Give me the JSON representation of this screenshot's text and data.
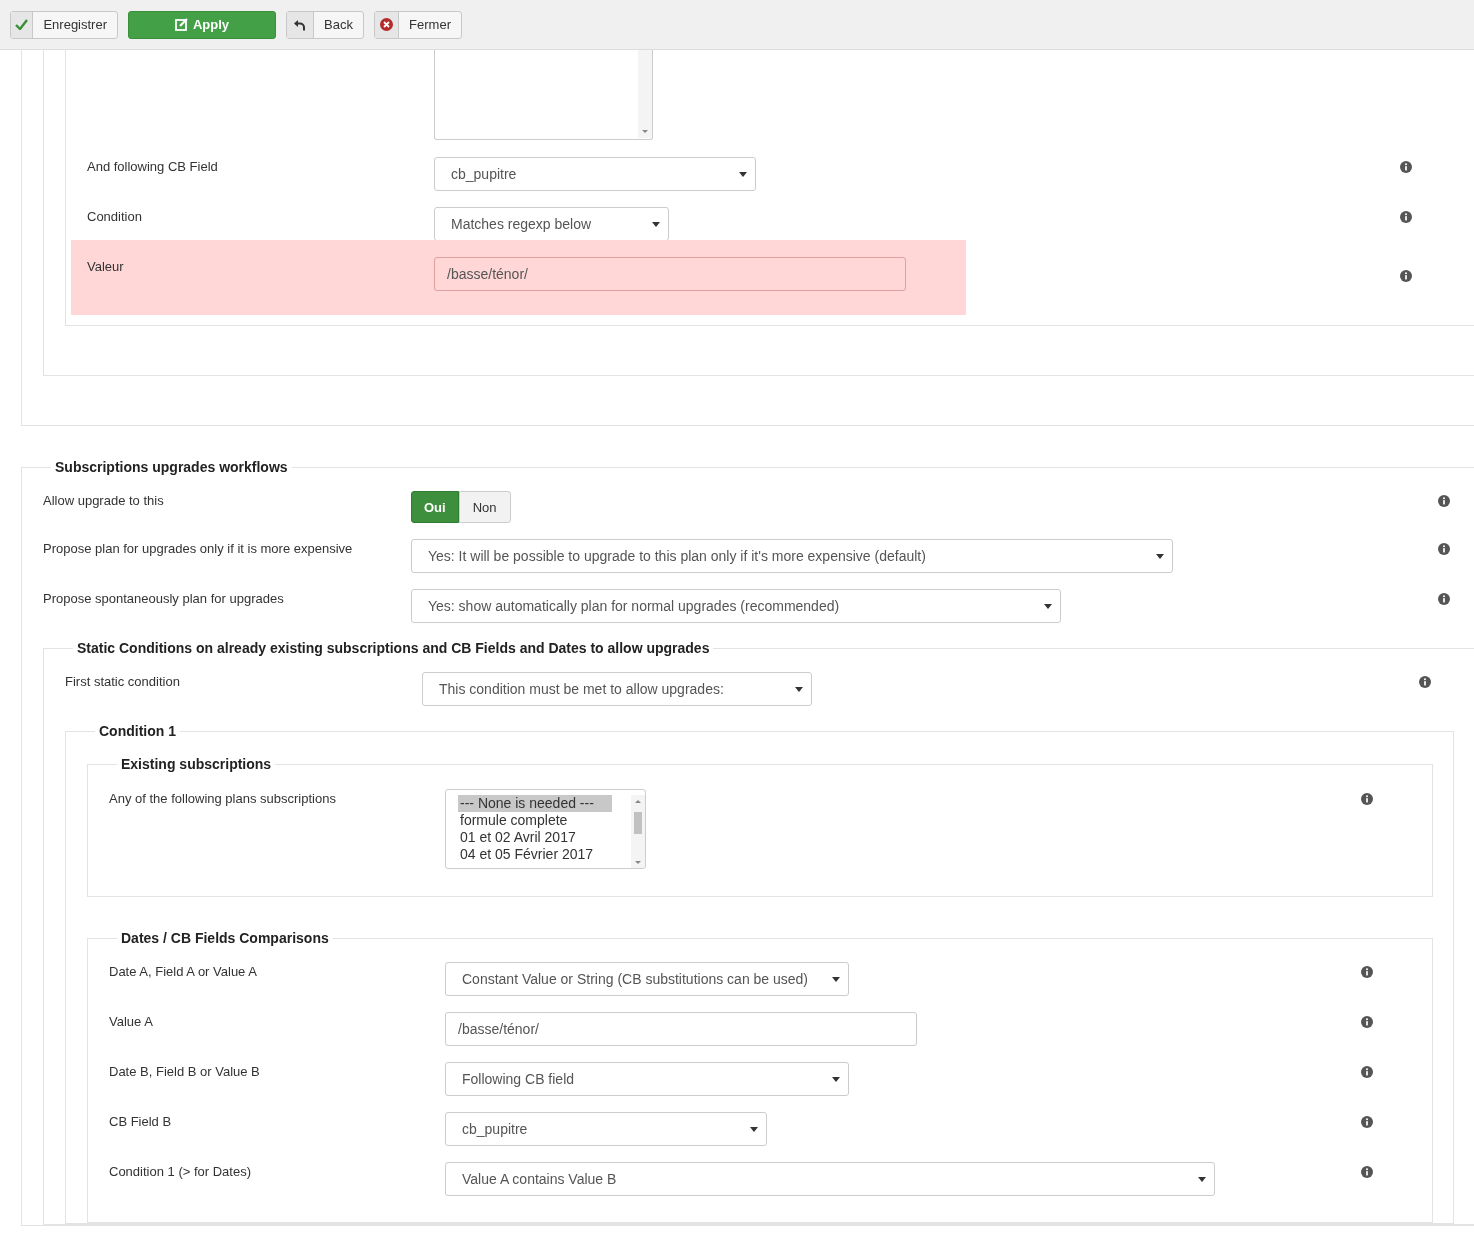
{
  "toolbar": {
    "buttons": [
      {
        "kind": "save",
        "label": "Enregistrer"
      },
      {
        "kind": "apply",
        "label": "Apply"
      },
      {
        "kind": "back",
        "label": "Back"
      },
      {
        "kind": "close",
        "label": "Fermer"
      }
    ]
  },
  "condition_fields": [
    {
      "label": "And following CB Field",
      "kind": "select",
      "value": "cb_pupitre",
      "error": false
    },
    {
      "label": "Condition",
      "kind": "select",
      "value": "Matches regexp below",
      "error": false
    },
    {
      "label": "Valeur",
      "kind": "input",
      "value": "/basse/ténor/",
      "error": true
    }
  ],
  "upgrades": {
    "title": "Subscriptions upgrades workflows",
    "fields": [
      {
        "label": "Allow upgrade to this",
        "kind": "toggle",
        "options": [
          {
            "label": "Oui",
            "selected": true
          },
          {
            "label": "Non",
            "selected": false
          }
        ]
      },
      {
        "label": "Propose plan for upgrades only if it is more expensive",
        "kind": "select",
        "value": "Yes: It will be possible to upgrade to this plan only if it's more expensive (default)"
      },
      {
        "label": "Propose spontaneously plan for upgrades",
        "kind": "select",
        "value": "Yes: show automatically plan for normal upgrades (recommended)"
      }
    ],
    "static_conditions": {
      "title": "Static Conditions on already existing subscriptions and CB Fields and Dates to allow upgrades",
      "fields": [
        {
          "label": "First static condition",
          "kind": "select",
          "value": "This condition must be met to allow upgrades:"
        }
      ],
      "condition": {
        "title": "Condition 1",
        "existing": {
          "title": "Existing subscriptions",
          "fields": [
            {
              "label": "Any of the following plans subscriptions",
              "kind": "listbox",
              "options": [
                {
                  "label": "--- None is needed ---",
                  "selected": true
                },
                {
                  "label": "formule complete",
                  "selected": false
                },
                {
                  "label": "01 et 02 Avril 2017",
                  "selected": false
                },
                {
                  "label": "04 et 05 Février 2017",
                  "selected": false
                }
              ]
            }
          ]
        },
        "comparisons": {
          "title": "Dates / CB Fields Comparisons",
          "fields": [
            {
              "label": "Date A, Field A or Value A",
              "kind": "select",
              "value": "Constant Value or String (CB substitutions can be used)"
            },
            {
              "label": "Value A",
              "kind": "input",
              "value": "/basse/ténor/"
            },
            {
              "label": "Date B, Field B or Value B",
              "kind": "select",
              "value": "Following CB field"
            },
            {
              "label": "CB Field B",
              "kind": "select",
              "value": "cb_pupitre"
            },
            {
              "label": "Condition 1 (> for Dates)",
              "kind": "select",
              "value": "Value A contains Value B"
            }
          ]
        }
      }
    }
  }
}
